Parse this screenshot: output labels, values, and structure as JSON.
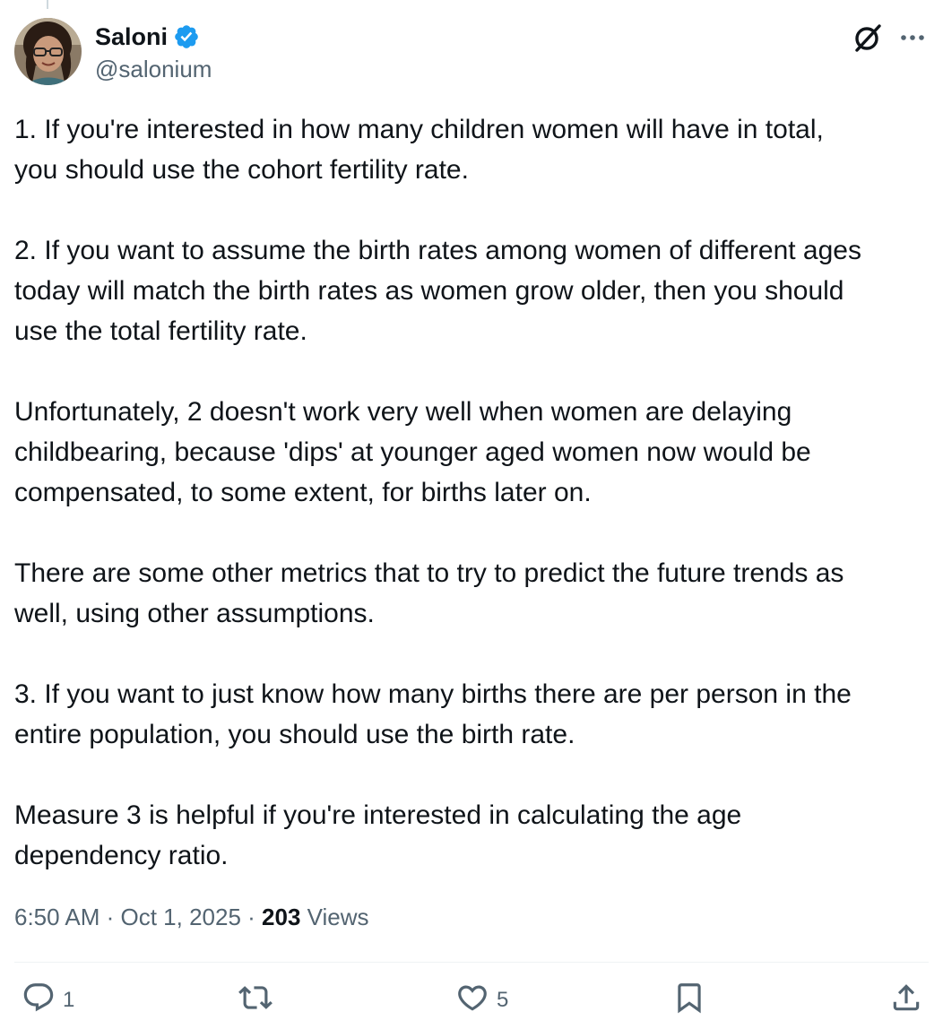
{
  "author": {
    "display_name": "Saloni",
    "handle": "@salonium",
    "verified": true,
    "verified_badge_icon": "verified-badge-icon",
    "accent_color": "#1d9bf0"
  },
  "header_actions": {
    "grok_icon": "grok-icon",
    "more_icon": "more-icon"
  },
  "tweet": {
    "paragraphs": [
      "1. If you're interested in how many children women will have in total,\nyou should use the cohort fertility rate.",
      "2. If you want to assume the birth rates among women of different ages\ntoday will match the birth rates as women grow older, then you should\nuse the total fertility rate.",
      "Unfortunately, 2 doesn't work very well when women are delaying\nchildbearing, because 'dips' at younger aged women now would be\ncompensated, to some extent, for births later on.",
      "There are some other metrics that to try to predict the future trends as\nwell, using other assumptions.",
      "3. If you want to just know how many births there are per person in the\nentire population, you should use the birth rate.",
      "Measure 3 is helpful if you're interested in calculating the age\ndependency ratio."
    ]
  },
  "meta": {
    "time": "6:50 AM",
    "separator": " · ",
    "date": "Oct 1, 2025",
    "views_count": "203",
    "views_label": " Views"
  },
  "actions": {
    "reply": {
      "icon": "reply-icon",
      "count": "1"
    },
    "repost": {
      "icon": "repost-icon",
      "count": ""
    },
    "like": {
      "icon": "like-icon",
      "count": "5"
    },
    "bookmark": {
      "icon": "bookmark-icon",
      "count": ""
    },
    "share": {
      "icon": "share-icon",
      "count": ""
    }
  },
  "colors": {
    "text_primary": "#0f1419",
    "text_secondary": "#536471",
    "divider": "#eff3f4",
    "verified_blue": "#1d9bf0"
  }
}
